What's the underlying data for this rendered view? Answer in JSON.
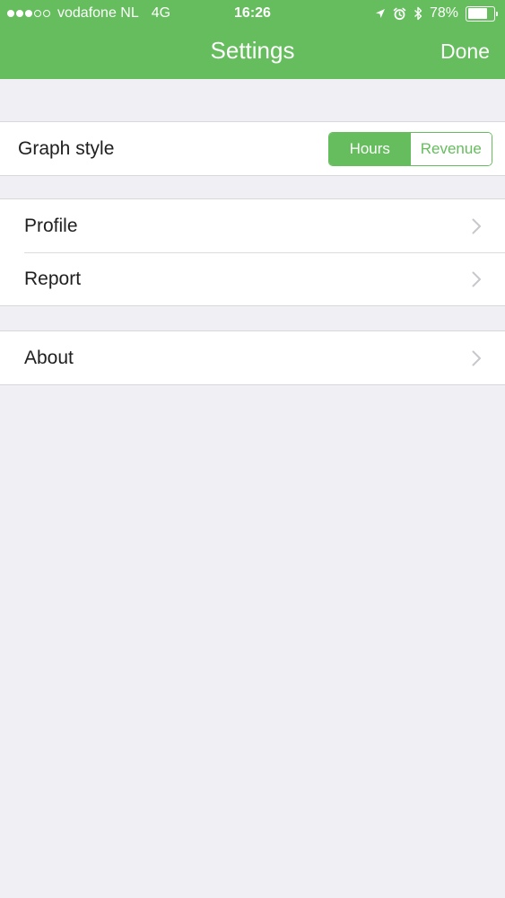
{
  "status_bar": {
    "carrier": "vodafone NL",
    "network": "4G",
    "time": "16:26",
    "battery_percent": "78%",
    "battery_level": 0.78,
    "signal_bars_filled": 3,
    "signal_bars_total": 5,
    "icons": [
      "location-arrow-icon",
      "alarm-clock-icon",
      "bluetooth-icon",
      "battery-icon"
    ]
  },
  "nav": {
    "title": "Settings",
    "done_label": "Done"
  },
  "graph_style": {
    "label": "Graph style",
    "options": [
      "Hours",
      "Revenue"
    ],
    "selected": "Hours"
  },
  "menu": {
    "profile": "Profile",
    "report": "Report",
    "about": "About"
  },
  "colors": {
    "accent": "#65bd5d",
    "background": "#efeff4",
    "chevron": "#c7c7cc"
  }
}
